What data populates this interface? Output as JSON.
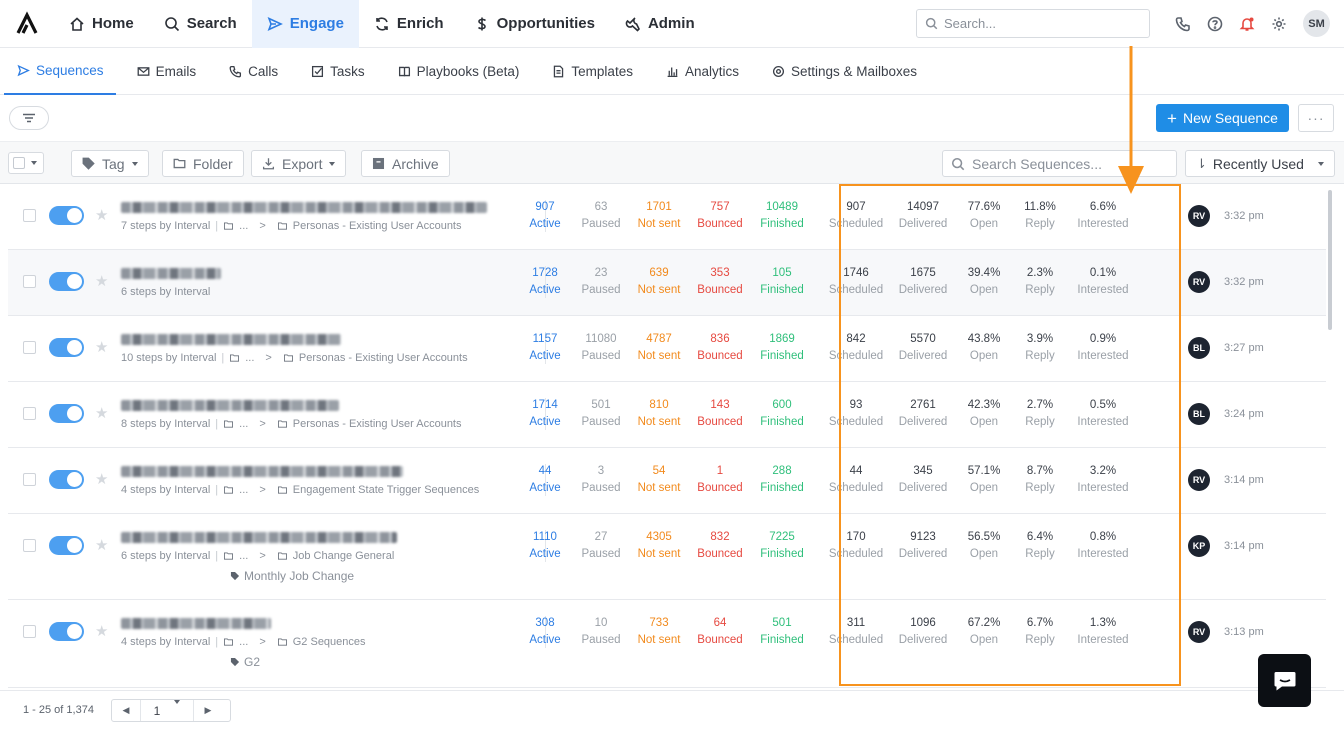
{
  "top_nav": {
    "items": [
      {
        "label": "Home",
        "icon": "home-icon"
      },
      {
        "label": "Search",
        "icon": "search-icon"
      },
      {
        "label": "Engage",
        "icon": "send-icon",
        "active": true
      },
      {
        "label": "Enrich",
        "icon": "refresh-icon"
      },
      {
        "label": "Opportunities",
        "icon": "dollar-icon"
      },
      {
        "label": "Admin",
        "icon": "wrench-icon"
      }
    ],
    "search_placeholder": "Search...",
    "user_initials": "SM"
  },
  "sub_nav": {
    "items": [
      {
        "label": "Sequences",
        "active": true
      },
      {
        "label": "Emails"
      },
      {
        "label": "Calls"
      },
      {
        "label": "Tasks"
      },
      {
        "label": "Playbooks (Beta)"
      },
      {
        "label": "Templates"
      },
      {
        "label": "Analytics"
      },
      {
        "label": "Settings & Mailboxes"
      }
    ]
  },
  "toolbar": {
    "new_sequence_label": "New Sequence",
    "more_label": "···",
    "tag_label": "Tag",
    "folder_label": "Folder",
    "export_label": "Export",
    "archive_label": "Archive",
    "search_placeholder": "Search Sequences...",
    "sort_label": "Recently Used"
  },
  "stat_labels": {
    "active": "Active",
    "paused": "Paused",
    "not_sent": "Not sent",
    "bounced": "Bounced",
    "finished": "Finished",
    "scheduled": "Scheduled",
    "delivered": "Delivered",
    "open": "Open",
    "reply": "Reply",
    "interested": "Interested"
  },
  "sequences": [
    {
      "steps": "7 steps by Interval",
      "folder": "Personas - Existing User Accounts",
      "tag": "",
      "active": "907",
      "paused": "63",
      "not_sent": "1701",
      "bounced": "757",
      "finished": "10489",
      "scheduled": "907",
      "delivered": "14097",
      "open": "77.6%",
      "reply": "11.8%",
      "interested": "6.6%",
      "owner": "RV",
      "time": "3:32 pm"
    },
    {
      "steps": "6 steps by Interval",
      "folder": "",
      "tag": "",
      "active": "1728",
      "paused": "23",
      "not_sent": "639",
      "bounced": "353",
      "finished": "105",
      "scheduled": "1746",
      "delivered": "1675",
      "open": "39.4%",
      "reply": "2.3%",
      "interested": "0.1%",
      "owner": "RV",
      "time": "3:32 pm"
    },
    {
      "steps": "10 steps by Interval",
      "folder": "Personas - Existing User Accounts",
      "tag": "",
      "active": "1157",
      "paused": "11080",
      "not_sent": "4787",
      "bounced": "836",
      "finished": "1869",
      "scheduled": "842",
      "delivered": "5570",
      "open": "43.8%",
      "reply": "3.9%",
      "interested": "0.9%",
      "owner": "BL",
      "time": "3:27 pm"
    },
    {
      "steps": "8 steps by Interval",
      "folder": "Personas - Existing User Accounts",
      "tag": "",
      "active": "1714",
      "paused": "501",
      "not_sent": "810",
      "bounced": "143",
      "finished": "600",
      "scheduled": "93",
      "delivered": "2761",
      "open": "42.3%",
      "reply": "2.7%",
      "interested": "0.5%",
      "owner": "BL",
      "time": "3:24 pm"
    },
    {
      "steps": "4 steps by Interval",
      "folder": "Engagement State Trigger Sequences",
      "tag": "",
      "active": "44",
      "paused": "3",
      "not_sent": "54",
      "bounced": "1",
      "finished": "288",
      "scheduled": "44",
      "delivered": "345",
      "open": "57.1%",
      "reply": "8.7%",
      "interested": "3.2%",
      "owner": "RV",
      "time": "3:14 pm"
    },
    {
      "steps": "6 steps by Interval",
      "folder": "Job Change General",
      "tag": "Monthly Job Change",
      "active": "1110",
      "paused": "27",
      "not_sent": "4305",
      "bounced": "832",
      "finished": "7225",
      "scheduled": "170",
      "delivered": "9123",
      "open": "56.5%",
      "reply": "6.4%",
      "interested": "0.8%",
      "owner": "KP",
      "time": "3:14 pm"
    },
    {
      "steps": "4 steps by Interval",
      "folder": "G2 Sequences",
      "tag": "G2",
      "active": "308",
      "paused": "10",
      "not_sent": "733",
      "bounced": "64",
      "finished": "501",
      "scheduled": "311",
      "delivered": "1096",
      "open": "67.2%",
      "reply": "6.7%",
      "interested": "1.3%",
      "owner": "RV",
      "time": "3:13 pm"
    }
  ],
  "pagination": {
    "range": "1 - 25 of 1,374",
    "page": "1"
  },
  "colors": {
    "accent": "#2d7de3",
    "highlight": "#f7931e",
    "not_sent": "#f28a1c",
    "bounced": "#e64940",
    "finished": "#2fbf7b"
  }
}
